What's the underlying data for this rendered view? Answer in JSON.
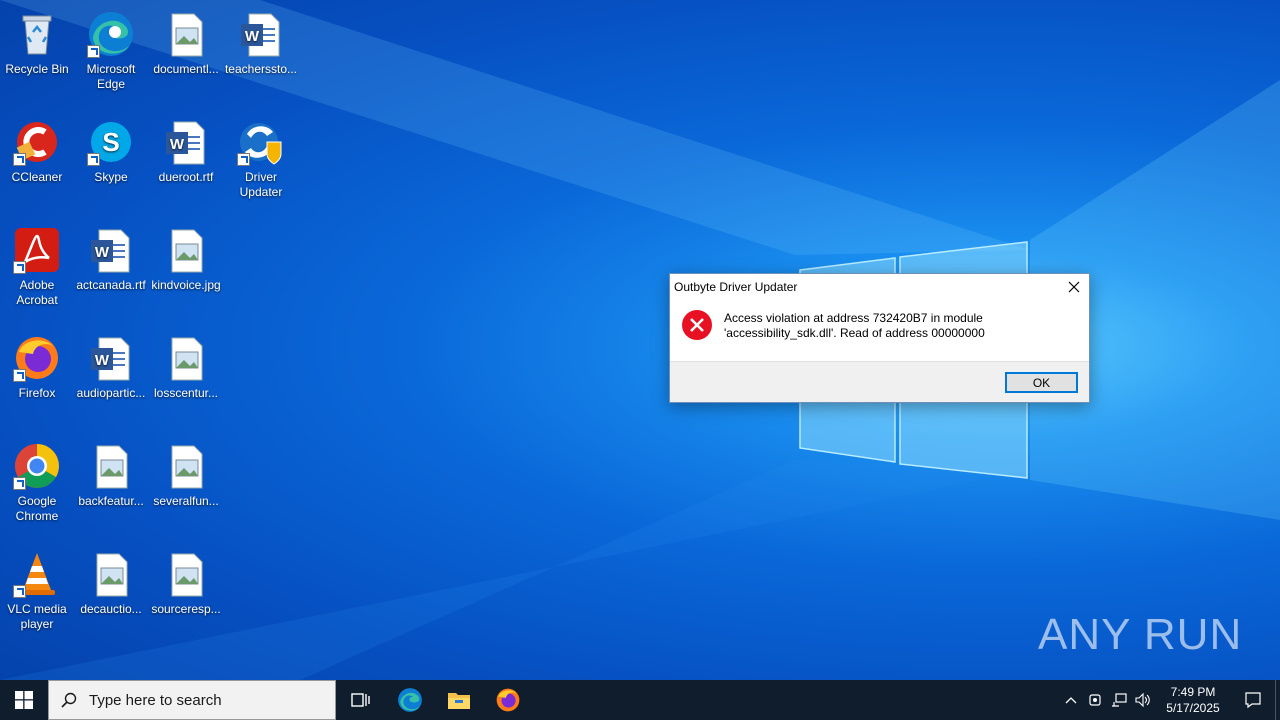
{
  "desktop": {
    "icons": [
      {
        "label": "Recycle Bin",
        "icon": "recycle-bin-icon"
      },
      {
        "label": "Microsoft Edge",
        "icon": "edge-icon"
      },
      {
        "label": "documentl...",
        "icon": "image-file-icon"
      },
      {
        "label": "teachersstо...",
        "icon": "word-document-icon"
      },
      {
        "label": "CCleaner",
        "icon": "ccleaner-icon"
      },
      {
        "label": "Skype",
        "icon": "skype-icon"
      },
      {
        "label": "dueroot.rtf",
        "icon": "word-document-icon"
      },
      {
        "label": "Driver Updater",
        "icon": "driver-updater-icon"
      },
      {
        "label": "Adobe Acrobat",
        "icon": "acrobat-icon"
      },
      {
        "label": "actcanada.rtf",
        "icon": "word-document-icon"
      },
      {
        "label": "kindvoice.jpg",
        "icon": "image-file-icon"
      },
      {
        "label": "Firefox",
        "icon": "firefox-icon"
      },
      {
        "label": "audiopartic...",
        "icon": "word-document-icon"
      },
      {
        "label": "losscentur...",
        "icon": "image-file-icon"
      },
      {
        "label": "Google Chrome",
        "icon": "chrome-icon"
      },
      {
        "label": "backfeatur...",
        "icon": "image-file-icon"
      },
      {
        "label": "severalfun...",
        "icon": "image-file-icon"
      },
      {
        "label": "VLC media player",
        "icon": "vlc-icon"
      },
      {
        "label": "decauctio...",
        "icon": "image-file-icon"
      },
      {
        "label": "sourceresp...",
        "icon": "image-file-icon"
      }
    ]
  },
  "dialog": {
    "title": "Outbyte Driver Updater",
    "message_line1": "Access violation at address 732420B7 in module",
    "message_line2": "'accessibility_sdk.dll'. Read of address 00000000",
    "ok_label": "OK",
    "close_glyph": "✕"
  },
  "watermark": {
    "text": "ANY RUN"
  },
  "taskbar": {
    "search_placeholder": "Type here to search",
    "pinned": [
      "task-view-icon",
      "edge-icon",
      "file-explorer-icon",
      "firefox-icon"
    ],
    "clock_time": "7:49 PM",
    "clock_date": "5/17/2025"
  },
  "colors": {
    "taskbar_bg": "#0f1d2c",
    "dialog_accent": "#0078d7",
    "error_red": "#e81123"
  }
}
